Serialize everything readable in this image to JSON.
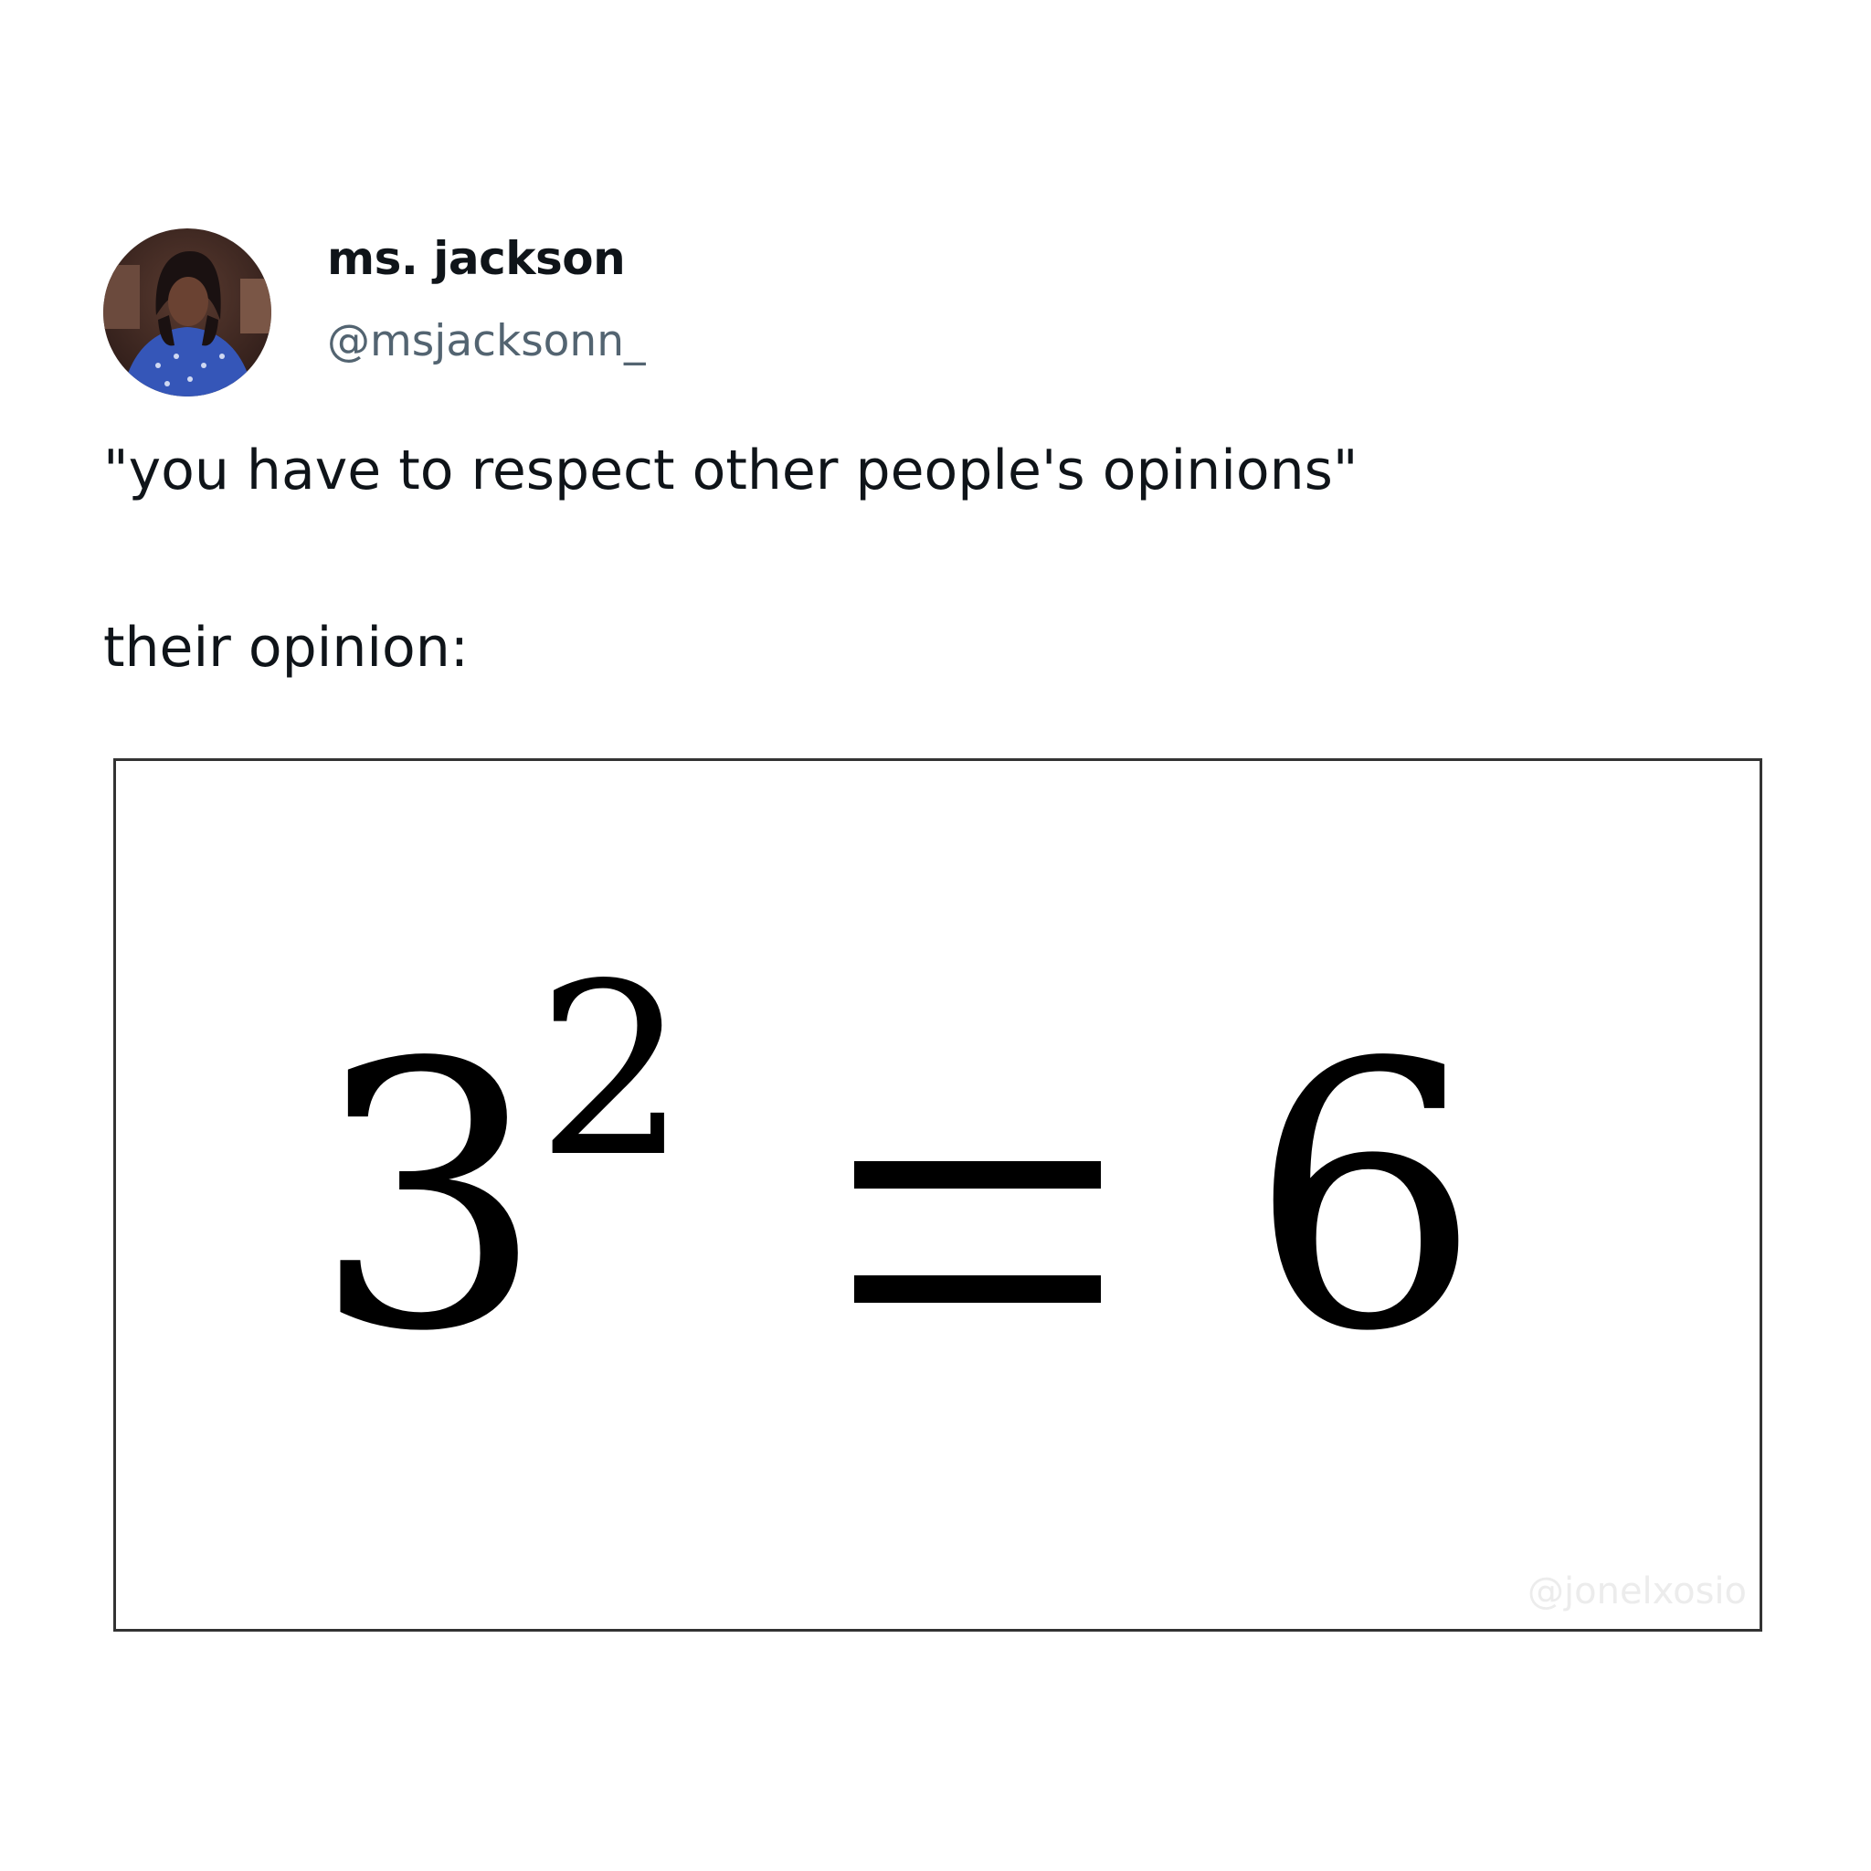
{
  "author": {
    "display_name": "ms. jackson",
    "handle": "@msjacksonn_",
    "avatar_icon": "avatar-photo"
  },
  "tweet": {
    "line_1": "\"you have to respect other people's opinions\"",
    "line_2": "their opinion:"
  },
  "media": {
    "base": "3",
    "exponent": "2",
    "equals": "=",
    "result": "6",
    "watermark": "@jonelxosio"
  },
  "colors": {
    "name": "#0f1419",
    "handle": "#536471",
    "text": "#0f1419",
    "frame": "#333333"
  }
}
